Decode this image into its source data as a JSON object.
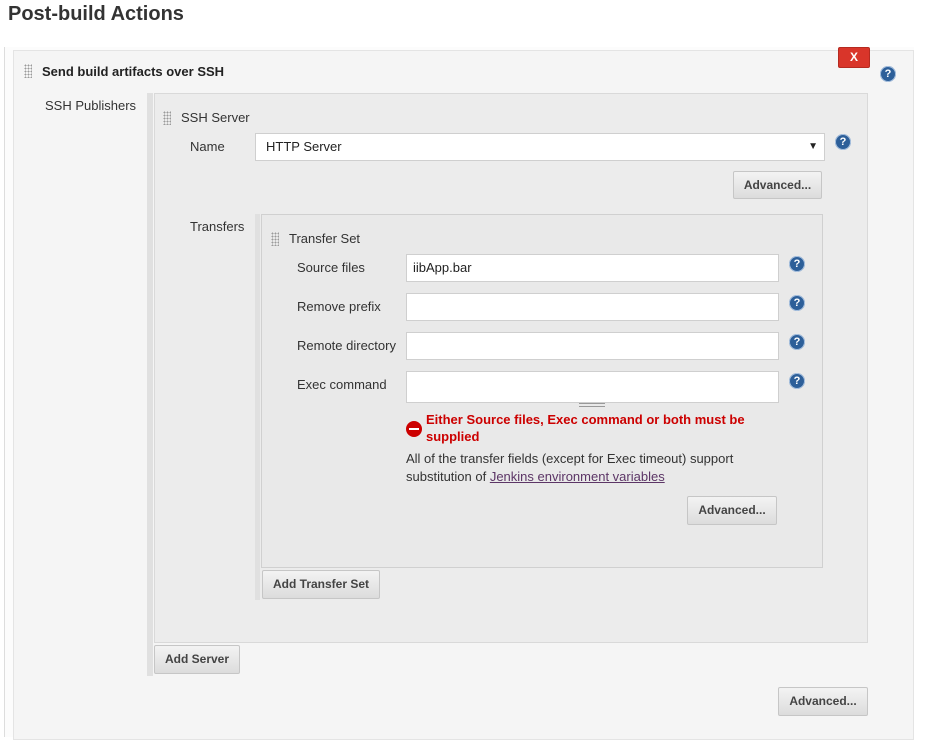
{
  "header": {
    "title": "Post-build Actions"
  },
  "publisher": {
    "title": "Send build artifacts over SSH",
    "delete_label": "X",
    "ssh_publishers_label": "SSH Publishers",
    "add_server_label": "Add Server",
    "advanced_label": "Advanced..."
  },
  "server": {
    "title": "SSH Server",
    "name_label": "Name",
    "name_value": "HTTP Server",
    "advanced_label": "Advanced...",
    "transfers_label": "Transfers"
  },
  "transfer_set": {
    "title": "Transfer Set",
    "source_files_label": "Source files",
    "source_files_value": "iibApp.bar",
    "remove_prefix_label": "Remove prefix",
    "remove_prefix_value": "",
    "remote_directory_label": "Remote directory",
    "remote_directory_value": "",
    "exec_command_label": "Exec command",
    "exec_command_value": "",
    "error_line1": "Either Source files, Exec command or both must be",
    "error_line2": "supplied",
    "info_line1": "All of the transfer fields (except for Exec timeout) support",
    "info_line2_prefix": "substitution of ",
    "info_link": "Jenkins environment variables",
    "advanced_label": "Advanced...",
    "add_transfer_set_label": "Add Transfer Set"
  },
  "colors": {
    "danger": "#d9352a",
    "help": "#2d5f99",
    "error": "#cc0000",
    "link": "#5c3566"
  },
  "icons": {
    "help": "help-icon",
    "error": "error-icon",
    "drag": "drag-handle-icon",
    "dropdown": "chevron-down-icon"
  }
}
